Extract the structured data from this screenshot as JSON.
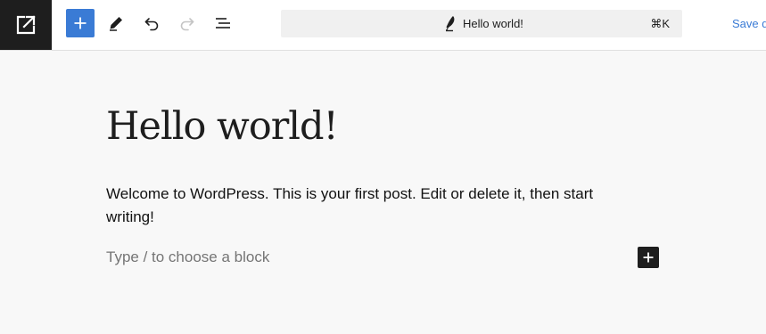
{
  "toolbar": {
    "exit_icon": "external-link-icon",
    "inserter_icon": "plus-icon",
    "tools_icon": "pencil-icon",
    "undo_icon": "undo-icon",
    "redo_icon": "redo-icon",
    "redo_enabled": false,
    "outline_icon": "list-view-icon",
    "accent_color": "#3a7bd5",
    "dark_color": "#1e1e1e",
    "save_label": "Save d"
  },
  "command_bar": {
    "icon": "quill-pen-icon",
    "title": "Hello world!",
    "shortcut": "⌘K"
  },
  "editor": {
    "title": "Hello world!",
    "paragraph": "Welcome to WordPress. This is your first post. Edit or delete it, then start writing!",
    "placeholder": "Type / to choose a block",
    "add_block_icon": "plus-icon"
  }
}
